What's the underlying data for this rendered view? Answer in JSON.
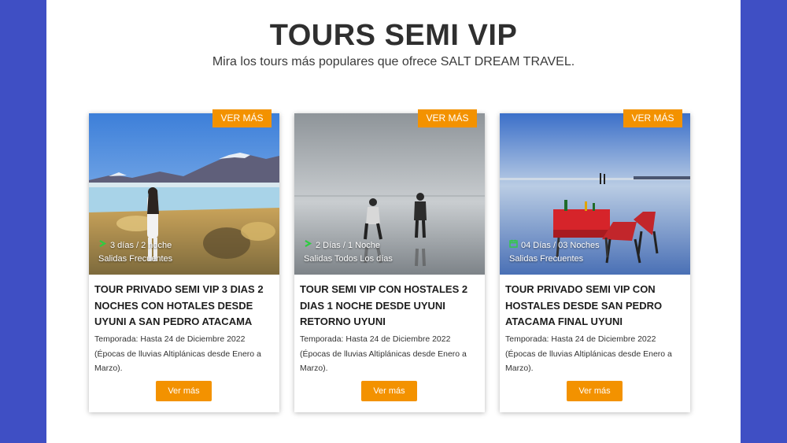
{
  "header": {
    "title": "TOURS SEMI VIP",
    "subtitle": "Mira los tours más populares que ofrece SALT DREAM TRAVEL."
  },
  "colors": {
    "accent": "#f39200",
    "frame": "#3f4fc4",
    "calendar_icon": "#2ecc40"
  },
  "cards": [
    {
      "tag": "VER MÁS",
      "duration": "3 días / 2 noche",
      "departures": "Salidas Frecuentes",
      "title": "TOUR PRIVADO SEMI VIP 3 DIAS 2 NOCHES CON HOTALES DESDE UYUNI A SAN PEDRO ATACAMA",
      "season": "Temporada: Hasta 24 de Diciembre 2022 (Épocas de lluvias Altiplánicas desde Enero a Marzo).",
      "button": "Ver más",
      "icon": "arrow-icon"
    },
    {
      "tag": "VER MÁS",
      "duration": "2 Días / 1 Noche",
      "departures": "Salidas Todos Los días",
      "title": "TOUR SEMI VIP CON HOSTALES 2 DIAS 1 NOCHE DESDE UYUNI RETORNO UYUNI",
      "season": "Temporada: Hasta 24 de Diciembre 2022 (Épocas de lluvias Altiplánicas desde Enero a Marzo).",
      "button": "Ver más",
      "icon": "arrow-icon"
    },
    {
      "tag": "VER MÁS",
      "duration": "04 Días / 03 Noches",
      "departures": "Salidas Frecuentes",
      "title": "TOUR PRIVADO SEMI VIP CON HOSTALES DESDE SAN PEDRO ATACAMA FINAL UYUNI",
      "season": "Temporada: Hasta 24 de Diciembre 2022 (Épocas de lluvias Altiplánicas desde Enero a Marzo).",
      "button": "Ver más",
      "icon": "calendar-icon"
    }
  ]
}
